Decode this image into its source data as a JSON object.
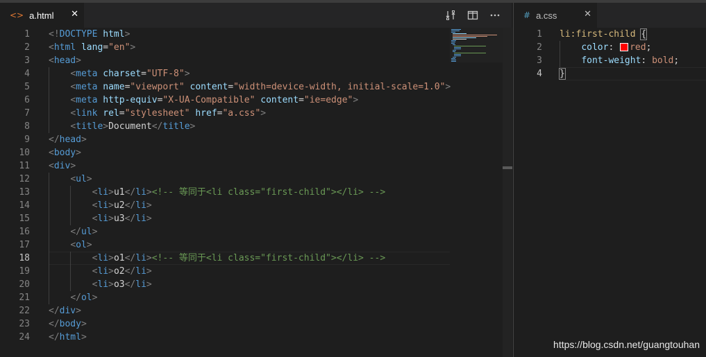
{
  "left_tab": {
    "icon": "<>",
    "label": "a.html",
    "close": "✕"
  },
  "right_tab": {
    "icon": "#",
    "label": "a.css",
    "close": "✕"
  },
  "colors": {
    "background": "#1e1e1e",
    "tabbar": "#252526",
    "tag": "#569cd6",
    "attribute": "#9cdcfe",
    "string": "#ce9178",
    "comment": "#6a9955",
    "selector": "#d7ba7d"
  },
  "editor": {
    "current_line": "18",
    "line_numbers": [
      "1",
      "2",
      "3",
      "4",
      "5",
      "6",
      "7",
      "8",
      "9",
      "10",
      "11",
      "12",
      "13",
      "14",
      "15",
      "16",
      "17",
      "18",
      "19",
      "20",
      "21",
      "22",
      "23",
      "24"
    ],
    "lines": [
      "<!DOCTYPE html>",
      "<html lang=\"en\">",
      "<head>",
      "    <meta charset=\"UTF-8\">",
      "    <meta name=\"viewport\" content=\"width=device-width, initial-scale=1.0\">",
      "    <meta http-equiv=\"X-UA-Compatible\" content=\"ie=edge\">",
      "    <link rel=\"stylesheet\" href=\"a.css\">",
      "    <title>Document</title>",
      "</head>",
      "<body>",
      "<div>",
      "    <ul>",
      "        <li>u1</li><!-- 等同于<li class=\"first-child\"></li> -->",
      "        <li>u2</li>",
      "        <li>u3</li>",
      "    </ul>",
      "    <ol>",
      "        <li>o1</li><!-- 等同于<li class=\"first-child\"></li> -->",
      "        <li>o2</li>",
      "        <li>o3</li>",
      "    </ol>",
      "</div>",
      "</body>",
      "</html>"
    ]
  },
  "css_editor": {
    "current_line": "4",
    "line_numbers": [
      "1",
      "2",
      "3",
      "4"
    ],
    "lines": [
      "li:first-child {",
      "    color: red;",
      "    font-weight: bold;",
      "}"
    ]
  },
  "watermark": "https://blog.csdn.net/guangtouhan"
}
